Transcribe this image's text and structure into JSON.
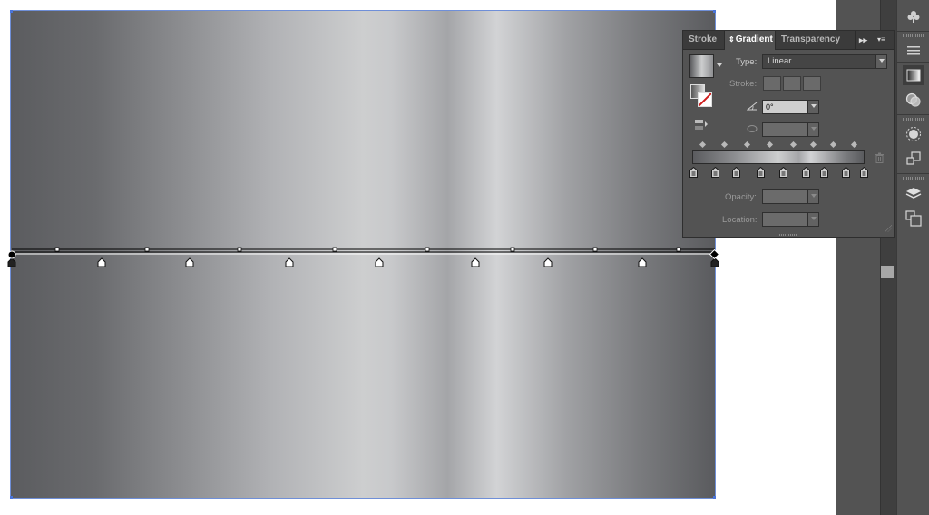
{
  "panel": {
    "tabs": [
      "Stroke",
      "Gradient",
      "Transparency"
    ],
    "active_tab": "Gradient",
    "type_label": "Type:",
    "type_value": "Linear",
    "stroke_label": "Stroke:",
    "angle_value": "0°",
    "opacity_label": "Opacity:",
    "location_label": "Location:"
  },
  "gradient": {
    "type": "linear",
    "colors": [
      "#5b5c5f",
      "#8e8f92",
      "#cdcecf",
      "#a4a5a8",
      "#d2d3d5",
      "#7b7c7f",
      "#5a5b5e"
    ],
    "stop_count": 9,
    "midpoint_count": 8
  },
  "colors": {
    "panel_bg": "#535353",
    "tabbar_bg": "#3b3b3b",
    "selection": "#4a74d8"
  },
  "icons": {
    "dock": [
      "club-icon",
      "menu-lines-icon",
      "gradient-swatch-icon",
      "transparency-circles-icon",
      "appearance-sun-icon",
      "transform-icon",
      "layers-icon",
      "artboards-icon"
    ]
  }
}
